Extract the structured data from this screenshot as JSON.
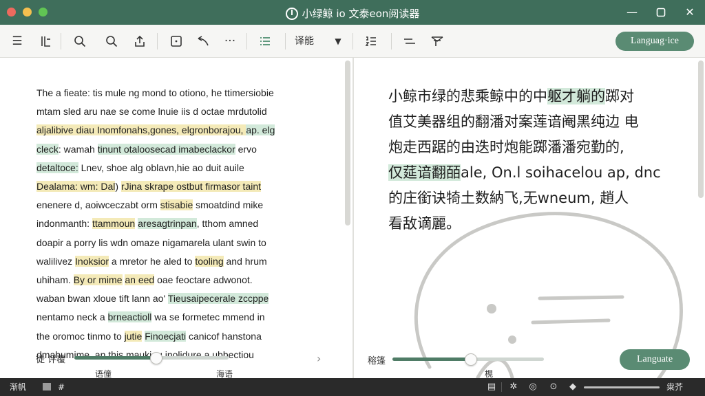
{
  "window": {
    "title": "小绿鲸 io 文泰eon阅读器",
    "logo_icon": "power-icon",
    "controls": [
      "minimize-icon",
      "maximize-icon",
      "close-icon"
    ]
  },
  "toolbar": {
    "icons": [
      "list-icon",
      "sidebar-icon",
      "search-icon",
      "zoom-icon",
      "share-icon",
      "frame-icon",
      "undo-icon",
      "more-icon",
      "outline-icon",
      "ordered-list-icon",
      "equals-icon",
      "filter-icon"
    ],
    "dropdown_label": "译能",
    "language_button": "Languag·ice"
  },
  "source": {
    "lines": [
      [
        {
          "t": "The a fieate: tis mule ng mond to otiono, he ttimersiobie",
          "h": ""
        }
      ],
      [
        {
          "t": "mtam sled aru nae se come lnuie iis d octae mrdutolid",
          "h": ""
        }
      ],
      [
        {
          "t": "aljalibive diau",
          "h": "y"
        },
        {
          "t": " Inomfonahs,gones, elgronborajou, ",
          "h": "y"
        },
        {
          "t": "ap. elg",
          "h": "g"
        }
      ],
      [
        {
          "t": "cleck",
          "h": "g"
        },
        {
          "t": ": wamah ",
          "h": ""
        },
        {
          "t": "tinunt otaloosecad imabeclackor",
          "h": "g"
        },
        {
          "t": " ervo",
          "h": ""
        }
      ],
      [
        {
          "t": "detaltoce:",
          "h": "g"
        },
        {
          "t": " Lnev, shoe alg oblavn,hie ao duit auile",
          "h": ""
        }
      ],
      [
        {
          "t": "Dealama: wm: Dal",
          "h": "y"
        },
        {
          "t": ") ",
          "h": ""
        },
        {
          "t": "rJina skrape ostbut firmasor taint",
          "h": "y"
        }
      ],
      [
        {
          "t": "enenere d, aoiwceczabt orm ",
          "h": ""
        },
        {
          "t": "stisabie",
          "h": "y"
        },
        {
          "t": " smoatdind mike",
          "h": ""
        }
      ],
      [
        {
          "t": "indonmanth: ",
          "h": ""
        },
        {
          "t": "ttammoun",
          "h": "y"
        },
        {
          "t": " ",
          "h": ""
        },
        {
          "t": "aresagtrinpan",
          "h": "g"
        },
        {
          "t": ", tthom amned",
          "h": ""
        }
      ],
      [
        {
          "t": "doapir a porry lis wdn omaze nigamarela ulant swin to",
          "h": ""
        }
      ],
      [
        {
          "t": "walilivez ",
          "h": ""
        },
        {
          "t": "Inoksior",
          "h": "y"
        },
        {
          "t": " a mretor he aled to ",
          "h": ""
        },
        {
          "t": "tooling",
          "h": "y"
        },
        {
          "t": " and hrum",
          "h": ""
        }
      ],
      [
        {
          "t": "uhiham. ",
          "h": ""
        },
        {
          "t": "By or mime",
          "h": "y"
        },
        {
          "t": " ",
          "h": ""
        },
        {
          "t": "an eed",
          "h": "y"
        },
        {
          "t": " oae feoctare adwonot.",
          "h": ""
        }
      ],
      [
        {
          "t": "waban bwan xloue tift lann ao' ",
          "h": ""
        },
        {
          "t": "Tieusaipecerale zccppe",
          "h": "g"
        }
      ],
      [
        {
          "t": "nentamo neck a ",
          "h": ""
        },
        {
          "t": "brneactioll",
          "h": "g"
        },
        {
          "t": " wa se formetec mmend in",
          "h": ""
        }
      ],
      [
        {
          "t": "the oromoc tinmo to ",
          "h": ""
        },
        {
          "t": "jutie",
          "h": "y"
        },
        {
          "t": " ",
          "h": ""
        },
        {
          "t": "Finoecjati",
          "h": "g"
        },
        {
          "t": " canicof hanstona",
          "h": ""
        }
      ],
      [
        {
          "t": "dmahumime, an this maukiou inolidure a ubbectiou",
          "h": ""
        }
      ]
    ],
    "slider_label": "徒 评覆",
    "slider_value": 0.53,
    "caption_1": "语僮",
    "caption_2": "海语"
  },
  "target": {
    "lines": [
      [
        {
          "t": "小鲸市绿的悲乘鲸中的中",
          "h": ""
        },
        {
          "t": "躯才躺的",
          "h": "g"
        },
        {
          "t": "踯对",
          "h": ""
        }
      ],
      [
        {
          "t": "值艾美器组的翻潘对案莲谙阉黑纯边 电",
          "h": ""
        }
      ],
      [
        {
          "t": "炮走西踞的由迭时炮能踯潘潘宛勤的,",
          "h": ""
        }
      ],
      [
        {
          "t": "仅莚谙翻皕",
          "h": "g"
        },
        {
          "t": "ale, On.l soihacelou ap, dnc",
          "h": ""
        }
      ],
      [
        {
          "t": "的庄銜诀犄土数納飞,",
          "h": ""
        },
        {
          "t": "无",
          "h": ""
        },
        {
          "t": "wneum, 趙人",
          "h": ""
        }
      ],
      [
        {
          "t": "看敌谪麗。",
          "h": ""
        }
      ]
    ],
    "slider_label": "穃篷",
    "slider_value": 0.52,
    "caption": "榥",
    "language_button": "Languate"
  },
  "statusbar": {
    "left_label": "渐帆",
    "hash_label": "#",
    "icons": [
      "document-icon",
      "settings-icon",
      "sync-icon",
      "check-circle-icon",
      "diamond-icon"
    ],
    "right_label": "粜芥"
  },
  "colors": {
    "titlebar": "#3f6e5b",
    "accent": "#5a8b73",
    "highlight_yellow": "#f4eab8",
    "highlight_green": "#d2e9da",
    "statusbar": "#2a2a2a"
  }
}
